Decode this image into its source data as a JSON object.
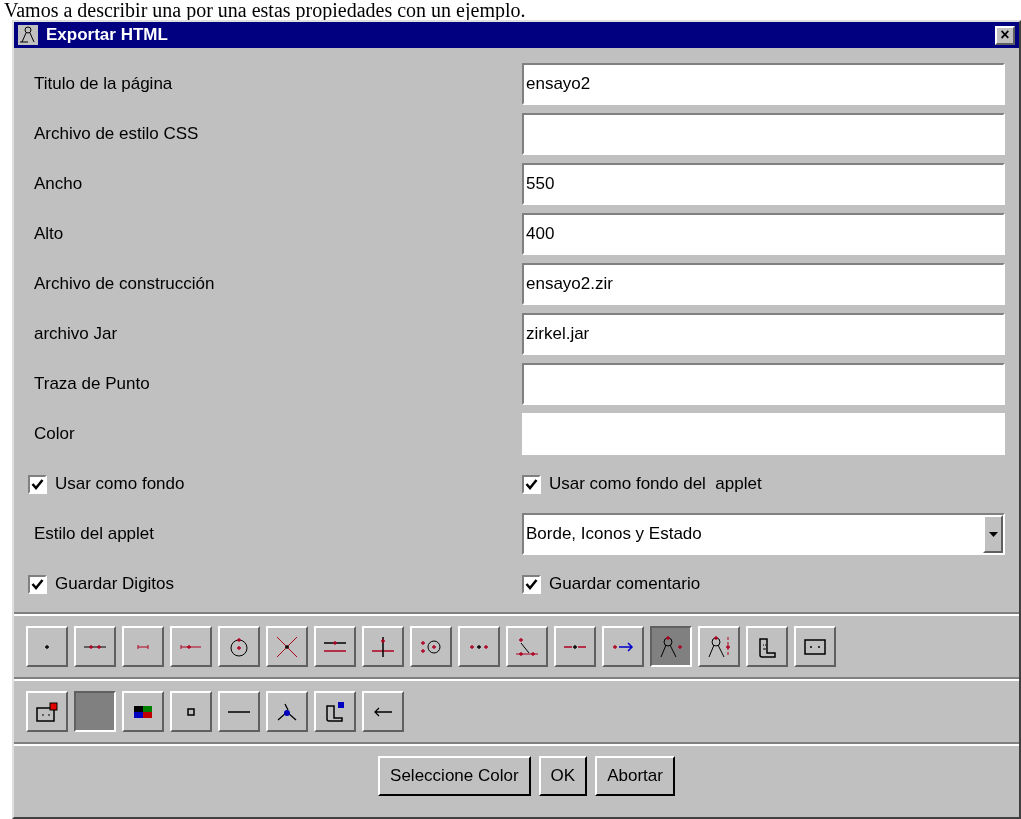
{
  "intro_text": "Vamos a describir una por una estas propiedades con un ejemplo.",
  "window": {
    "title": "Exportar HTML",
    "close": "×"
  },
  "rows": [
    {
      "kind": "text",
      "label": "Titulo de la página",
      "value": "ensayo2"
    },
    {
      "kind": "text",
      "label": "Archivo de estilo CSS",
      "value": ""
    },
    {
      "kind": "text",
      "label": "Ancho",
      "value": "550"
    },
    {
      "kind": "text",
      "label": "Alto",
      "value": "400"
    },
    {
      "kind": "text",
      "label": "Archivo de construcción",
      "value": "ensayo2.zir"
    },
    {
      "kind": "text",
      "label": "archivo Jar",
      "value": "zirkel.jar"
    },
    {
      "kind": "text",
      "label": "Traza de Punto",
      "value": ""
    },
    {
      "kind": "color",
      "label": "Color",
      "color": "#ffffff"
    },
    {
      "kind": "checks",
      "items": [
        {
          "label": "Usar como fondo",
          "checked": true
        },
        {
          "label": "Usar como fondo del  applet",
          "checked": true
        }
      ]
    },
    {
      "kind": "select",
      "label": "Estilo del applet",
      "value": "Borde, Iconos y Estado"
    },
    {
      "kind": "checks",
      "items": [
        {
          "label": "Guardar Digitos",
          "checked": true
        },
        {
          "label": "Guardar comentario",
          "checked": true
        }
      ]
    }
  ],
  "toolbar_1": [
    {
      "selected": false
    },
    {
      "selected": false
    },
    {
      "selected": false
    },
    {
      "selected": false
    },
    {
      "selected": false
    },
    {
      "selected": false
    },
    {
      "selected": false
    },
    {
      "selected": false
    },
    {
      "selected": false
    },
    {
      "selected": false
    },
    {
      "selected": false
    },
    {
      "selected": false
    },
    {
      "selected": false
    },
    {
      "selected": true
    },
    {
      "selected": false
    },
    {
      "selected": false
    },
    {
      "selected": false
    }
  ],
  "toolbar_2": [
    {
      "selected": false
    },
    {
      "selected": true
    },
    {
      "selected": false
    },
    {
      "selected": false
    },
    {
      "selected": false
    },
    {
      "selected": false
    },
    {
      "selected": false
    },
    {
      "selected": false
    }
  ],
  "buttons": [
    "Seleccione Color",
    "OK",
    "Abortar"
  ]
}
